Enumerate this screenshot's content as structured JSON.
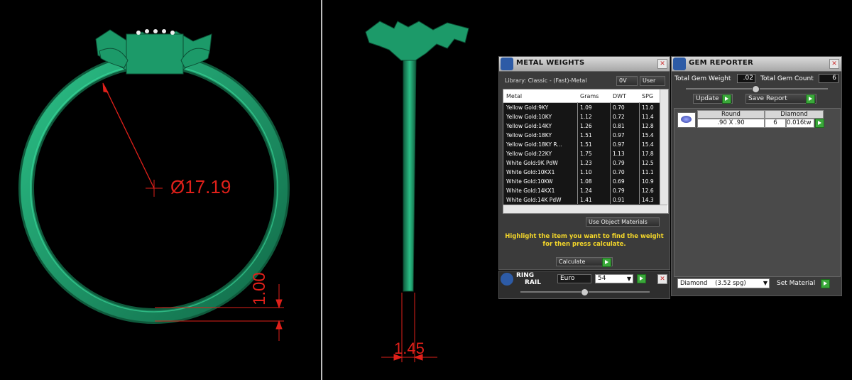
{
  "viewport": {
    "front_view": {
      "diameter_label": "Ø17.19",
      "thickness_label": "1.00"
    },
    "side_view": {
      "width_label": "1.45"
    }
  },
  "metal_weights": {
    "title": "METAL WEIGHTS",
    "library_label": "Library: Classic - (Fast)-Metal",
    "toggle_1": "0V",
    "toggle_2": "User",
    "columns": [
      "Metal",
      "Grams",
      "DWT",
      "SPG"
    ],
    "rows": [
      [
        "Yellow Gold:9KY",
        "1.09",
        "0.70",
        "11.0"
      ],
      [
        "Yellow Gold:10KY",
        "1.12",
        "0.72",
        "11.4"
      ],
      [
        "Yellow Gold:14KY",
        "1.26",
        "0.81",
        "12.8"
      ],
      [
        "Yellow Gold:18KY",
        "1.51",
        "0.97",
        "15.4"
      ],
      [
        "Yellow Gold:18KY R...",
        "1.51",
        "0.97",
        "15.4"
      ],
      [
        "Yellow Gold:22KY",
        "1.75",
        "1.13",
        "17.8"
      ],
      [
        "White Gold:9K PdW",
        "1.23",
        "0.79",
        "12.5"
      ],
      [
        "White Gold:10KX1",
        "1.10",
        "0.70",
        "11.1"
      ],
      [
        "White Gold:10KW",
        "1.08",
        "0.69",
        "10.9"
      ],
      [
        "White Gold:14KX1",
        "1.24",
        "0.79",
        "12.6"
      ],
      [
        "White Gold:14K PdW",
        "1.41",
        "0.91",
        "14.3"
      ]
    ],
    "use_object_materials": "Use Object Materials",
    "message_line1": "Highlight the item you want to find the weight",
    "message_line2": "for then press calculate.",
    "calculate_button": "Calculate"
  },
  "ring_rail": {
    "title_line1": "RING",
    "title_line2": "RAIL",
    "standard": "Euro",
    "size": "54"
  },
  "gem_reporter": {
    "title": "GEM REPORTER",
    "total_weight_label": "Total Gem Weight",
    "total_weight_value": ".02",
    "total_count_label": "Total Gem Count",
    "total_count_value": "6",
    "update_button": "Update",
    "save_report_button": "Save Report",
    "gem": {
      "shape": "Round",
      "size": ".90 X .90",
      "material": "Diamond",
      "count": "6",
      "weight": "0.016tw"
    },
    "material_select": "Diamond    (3.52 spg)",
    "set_material_button": "Set Material"
  },
  "colors": {
    "ring_green": "#1f9a6a",
    "dimension_red": "#e0201a",
    "message_yellow": "#f2d52a",
    "accent_green": "#3aa83a"
  }
}
